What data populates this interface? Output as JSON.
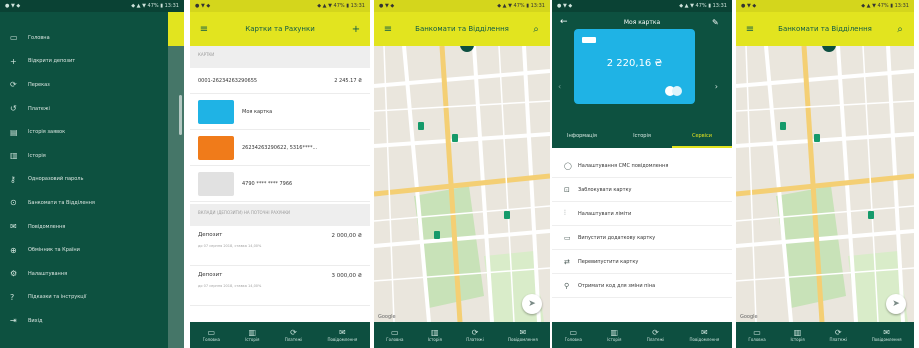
{
  "status": {
    "left": "● ▼ ◆",
    "right": "◆ ▲ ▼ 47% ▮ 13:31"
  },
  "colors": {
    "accent": "#e2e41f",
    "primary_dark": "#0d5140",
    "card_blue": "#1fb3e5",
    "card_orange": "#f07b1a"
  },
  "menu": {
    "items": [
      {
        "icon": "card-icon",
        "glyph": "▭",
        "label": "Головна"
      },
      {
        "icon": "plus-icon",
        "glyph": "+",
        "label": "Відкрити депозит"
      },
      {
        "icon": "transfer-icon",
        "glyph": "⟳",
        "label": "Переказ"
      },
      {
        "icon": "payment-icon",
        "glyph": "↺",
        "label": "Платежі"
      },
      {
        "icon": "history-icon",
        "glyph": "▤",
        "label": "Історія заявок"
      },
      {
        "icon": "chart-icon",
        "glyph": "▥",
        "label": "Історія"
      },
      {
        "icon": "key-icon",
        "glyph": "⚷",
        "label": "Одноразовий пароль"
      },
      {
        "icon": "location-icon",
        "glyph": "⊙",
        "label": "Банкомати та Відділення"
      },
      {
        "icon": "mail-icon",
        "glyph": "✉",
        "label": "Повідомлення"
      },
      {
        "icon": "globe-icon",
        "glyph": "⊕",
        "label": "Обмінник та Країни"
      },
      {
        "icon": "settings-icon",
        "glyph": "⚙",
        "label": "Налаштування"
      },
      {
        "icon": "help-icon",
        "glyph": "?",
        "label": "Підказки та інструкції"
      },
      {
        "icon": "logout-icon",
        "glyph": "⇥",
        "label": "Вихід"
      }
    ]
  },
  "accounts": {
    "title": "Картки та Рахунки",
    "section_cards": "КАРТКИ",
    "account_number": "0001-26234263290655",
    "account_amount": "2 245.17 ₴",
    "cards": [
      {
        "color": "#1fb3e5",
        "name": "Моя картка"
      },
      {
        "color": "#f07b1a",
        "name": "26234263290622, 5316****..."
      },
      {
        "color": "#e1e1e1",
        "name": "4790 **** **** 7966"
      }
    ],
    "section_deposits": "ВКЛАДИ (ДЕПОЗИТИ) НА ПОТОЧНІ РАХУНКИ",
    "deposits": [
      {
        "title": "Депозит",
        "sub": "до 07 серпня 2018, ставка 14,00%",
        "value": "2 000,00 ₴"
      },
      {
        "title": "Депозит",
        "sub": "до 07 серпня 2018, ставка 14,00%",
        "value": "3 000,00 ₴"
      }
    ]
  },
  "atm": {
    "title": "Банкомати та Відділення",
    "cluster_badge": "14",
    "google": "Google"
  },
  "card_screen": {
    "title": "Моя картка",
    "balance": "2 220,16 ₴",
    "tabs": [
      "Інформація",
      "Історія",
      "Сервіси"
    ],
    "services": [
      {
        "icon": "sms-icon",
        "glyph": "◯",
        "label": "Налаштування СМС повідомлення"
      },
      {
        "icon": "lock-icon",
        "glyph": "⊡",
        "label": "Заблокувати картку"
      },
      {
        "icon": "limits-icon",
        "glyph": "⫶",
        "label": "Налаштувати ліміти"
      },
      {
        "icon": "add-card-icon",
        "glyph": "▭",
        "label": "Випустити додаткову картку"
      },
      {
        "icon": "reissue-icon",
        "glyph": "⇄",
        "label": "Перевипустити картку"
      },
      {
        "icon": "code-icon",
        "glyph": "⚲",
        "label": "Отримати код для зміни піна"
      }
    ]
  },
  "bottom_nav": [
    {
      "icon": "home-icon",
      "glyph": "▭",
      "label": "Головна"
    },
    {
      "icon": "history-icon",
      "glyph": "▥",
      "label": "Історія"
    },
    {
      "icon": "payments-icon",
      "glyph": "⟳",
      "label": "Платежі"
    },
    {
      "icon": "messages-icon",
      "glyph": "✉",
      "label": "Повідомлення"
    }
  ]
}
